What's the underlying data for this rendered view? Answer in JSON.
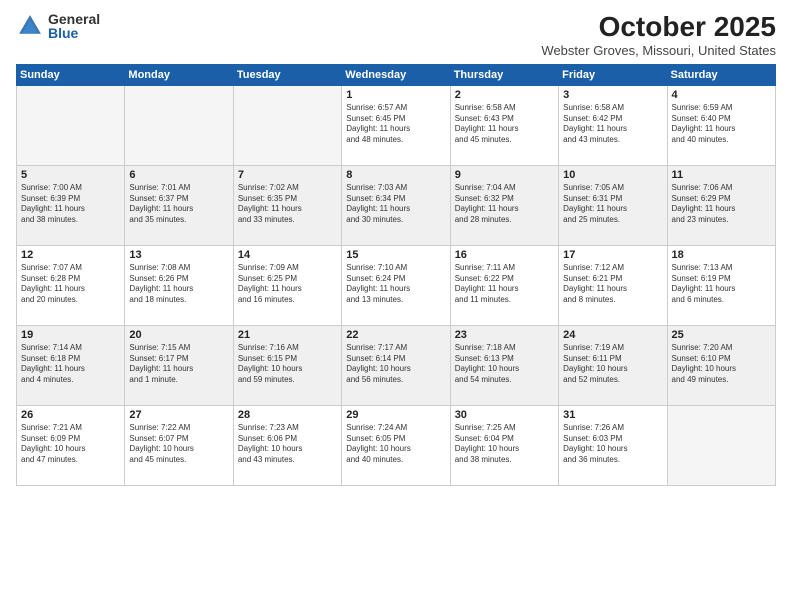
{
  "logo": {
    "general": "General",
    "blue": "Blue"
  },
  "title": "October 2025",
  "location": "Webster Groves, Missouri, United States",
  "weekdays": [
    "Sunday",
    "Monday",
    "Tuesday",
    "Wednesday",
    "Thursday",
    "Friday",
    "Saturday"
  ],
  "weeks": [
    [
      {
        "day": "",
        "info": "",
        "empty": true
      },
      {
        "day": "",
        "info": "",
        "empty": true
      },
      {
        "day": "",
        "info": "",
        "empty": true
      },
      {
        "day": "1",
        "info": "Sunrise: 6:57 AM\nSunset: 6:45 PM\nDaylight: 11 hours\nand 48 minutes."
      },
      {
        "day": "2",
        "info": "Sunrise: 6:58 AM\nSunset: 6:43 PM\nDaylight: 11 hours\nand 45 minutes."
      },
      {
        "day": "3",
        "info": "Sunrise: 6:58 AM\nSunset: 6:42 PM\nDaylight: 11 hours\nand 43 minutes."
      },
      {
        "day": "4",
        "info": "Sunrise: 6:59 AM\nSunset: 6:40 PM\nDaylight: 11 hours\nand 40 minutes."
      }
    ],
    [
      {
        "day": "5",
        "info": "Sunrise: 7:00 AM\nSunset: 6:39 PM\nDaylight: 11 hours\nand 38 minutes.",
        "shaded": true
      },
      {
        "day": "6",
        "info": "Sunrise: 7:01 AM\nSunset: 6:37 PM\nDaylight: 11 hours\nand 35 minutes.",
        "shaded": true
      },
      {
        "day": "7",
        "info": "Sunrise: 7:02 AM\nSunset: 6:35 PM\nDaylight: 11 hours\nand 33 minutes.",
        "shaded": true
      },
      {
        "day": "8",
        "info": "Sunrise: 7:03 AM\nSunset: 6:34 PM\nDaylight: 11 hours\nand 30 minutes.",
        "shaded": true
      },
      {
        "day": "9",
        "info": "Sunrise: 7:04 AM\nSunset: 6:32 PM\nDaylight: 11 hours\nand 28 minutes.",
        "shaded": true
      },
      {
        "day": "10",
        "info": "Sunrise: 7:05 AM\nSunset: 6:31 PM\nDaylight: 11 hours\nand 25 minutes.",
        "shaded": true
      },
      {
        "day": "11",
        "info": "Sunrise: 7:06 AM\nSunset: 6:29 PM\nDaylight: 11 hours\nand 23 minutes.",
        "shaded": true
      }
    ],
    [
      {
        "day": "12",
        "info": "Sunrise: 7:07 AM\nSunset: 6:28 PM\nDaylight: 11 hours\nand 20 minutes."
      },
      {
        "day": "13",
        "info": "Sunrise: 7:08 AM\nSunset: 6:26 PM\nDaylight: 11 hours\nand 18 minutes."
      },
      {
        "day": "14",
        "info": "Sunrise: 7:09 AM\nSunset: 6:25 PM\nDaylight: 11 hours\nand 16 minutes."
      },
      {
        "day": "15",
        "info": "Sunrise: 7:10 AM\nSunset: 6:24 PM\nDaylight: 11 hours\nand 13 minutes."
      },
      {
        "day": "16",
        "info": "Sunrise: 7:11 AM\nSunset: 6:22 PM\nDaylight: 11 hours\nand 11 minutes."
      },
      {
        "day": "17",
        "info": "Sunrise: 7:12 AM\nSunset: 6:21 PM\nDaylight: 11 hours\nand 8 minutes."
      },
      {
        "day": "18",
        "info": "Sunrise: 7:13 AM\nSunset: 6:19 PM\nDaylight: 11 hours\nand 6 minutes."
      }
    ],
    [
      {
        "day": "19",
        "info": "Sunrise: 7:14 AM\nSunset: 6:18 PM\nDaylight: 11 hours\nand 4 minutes.",
        "shaded": true
      },
      {
        "day": "20",
        "info": "Sunrise: 7:15 AM\nSunset: 6:17 PM\nDaylight: 11 hours\nand 1 minute.",
        "shaded": true
      },
      {
        "day": "21",
        "info": "Sunrise: 7:16 AM\nSunset: 6:15 PM\nDaylight: 10 hours\nand 59 minutes.",
        "shaded": true
      },
      {
        "day": "22",
        "info": "Sunrise: 7:17 AM\nSunset: 6:14 PM\nDaylight: 10 hours\nand 56 minutes.",
        "shaded": true
      },
      {
        "day": "23",
        "info": "Sunrise: 7:18 AM\nSunset: 6:13 PM\nDaylight: 10 hours\nand 54 minutes.",
        "shaded": true
      },
      {
        "day": "24",
        "info": "Sunrise: 7:19 AM\nSunset: 6:11 PM\nDaylight: 10 hours\nand 52 minutes.",
        "shaded": true
      },
      {
        "day": "25",
        "info": "Sunrise: 7:20 AM\nSunset: 6:10 PM\nDaylight: 10 hours\nand 49 minutes.",
        "shaded": true
      }
    ],
    [
      {
        "day": "26",
        "info": "Sunrise: 7:21 AM\nSunset: 6:09 PM\nDaylight: 10 hours\nand 47 minutes."
      },
      {
        "day": "27",
        "info": "Sunrise: 7:22 AM\nSunset: 6:07 PM\nDaylight: 10 hours\nand 45 minutes."
      },
      {
        "day": "28",
        "info": "Sunrise: 7:23 AM\nSunset: 6:06 PM\nDaylight: 10 hours\nand 43 minutes."
      },
      {
        "day": "29",
        "info": "Sunrise: 7:24 AM\nSunset: 6:05 PM\nDaylight: 10 hours\nand 40 minutes."
      },
      {
        "day": "30",
        "info": "Sunrise: 7:25 AM\nSunset: 6:04 PM\nDaylight: 10 hours\nand 38 minutes."
      },
      {
        "day": "31",
        "info": "Sunrise: 7:26 AM\nSunset: 6:03 PM\nDaylight: 10 hours\nand 36 minutes."
      },
      {
        "day": "",
        "info": "",
        "empty": true
      }
    ]
  ]
}
